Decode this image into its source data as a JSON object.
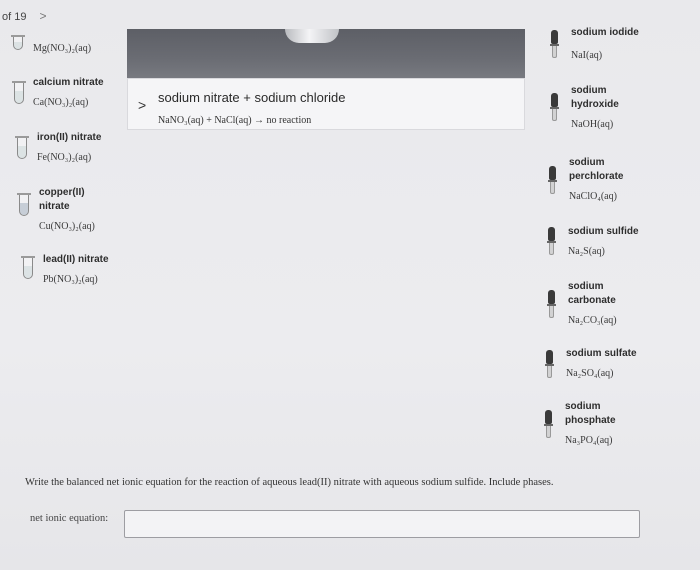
{
  "pager": {
    "text": "of 19",
    "next": ">"
  },
  "left_reagents": [
    {
      "name": "",
      "formula": "Mg(NO₃)₂(aq)"
    },
    {
      "name": "calcium nitrate",
      "formula": "Ca(NO₃)₂(aq)"
    },
    {
      "name": "iron(II) nitrate",
      "formula": "Fe(NO₃)₂(aq)"
    },
    {
      "name": "copper(II) nitrate",
      "formula": "Cu(NO₃)₂(aq)"
    },
    {
      "name": "lead(II) nitrate",
      "formula": "Pb(NO₃)₂(aq)"
    }
  ],
  "right_reagents": [
    {
      "name": "sodium iodide",
      "formula": "NaI(aq)"
    },
    {
      "name": "sodium hydroxide",
      "formula": "NaOH(aq)"
    },
    {
      "name": "sodium perchlorate",
      "formula": "NaClO₄(aq)"
    },
    {
      "name": "sodium sulfide",
      "formula": "Na₂S(aq)"
    },
    {
      "name": "sodium carbonate",
      "formula": "Na₂CO₃(aq)"
    },
    {
      "name": "sodium sulfate",
      "formula": "Na₂SO₄(aq)"
    },
    {
      "name": "sodium phosphate",
      "formula": "Na₃PO₄(aq)"
    }
  ],
  "reaction": {
    "title": "sodium nitrate + sodium chloride",
    "result": "NaNO₃(aq) + NaCl(aq) → no reaction",
    "arrow": ">"
  },
  "question": "Write the balanced net ionic equation for the reaction of aqueous lead(II) nitrate with aqueous sodium sulfide. Include phases.",
  "answer": {
    "label": "net ionic equation:",
    "value": ""
  }
}
